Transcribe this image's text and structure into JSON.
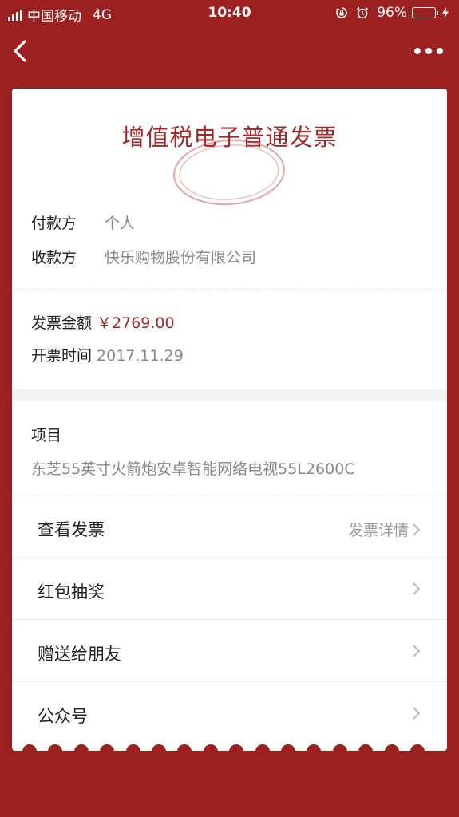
{
  "status_bar": {
    "carrier": "中国移动",
    "network": "4G",
    "time": "10:40",
    "battery_percent": "96%",
    "battery_level": 0.96
  },
  "nav": {
    "back_icon": "chevron-left-icon",
    "more_icon": "more-dots-icon"
  },
  "invoice": {
    "title": "增值税电子普通发票",
    "payer_label": "付款方",
    "payer_value": "个人",
    "payee_label": "收款方",
    "payee_value": "快乐购物股份有限公司",
    "amount_label": "发票金额",
    "amount_value": "￥2769.00",
    "date_label": "开票时间",
    "date_value": "2017.11.29",
    "item_label": "项目",
    "item_value": "东芝55英寸火箭炮安卓智能网络电视55L2600C"
  },
  "actions": [
    {
      "label": "查看发票",
      "right": "发票详情"
    },
    {
      "label": "红包抽奖",
      "right": ""
    },
    {
      "label": "赠送给朋友",
      "right": ""
    },
    {
      "label": "公众号",
      "right": ""
    }
  ],
  "colors": {
    "background": "#9c2020",
    "accent": "#a3282a",
    "battery": "#4cd964"
  }
}
